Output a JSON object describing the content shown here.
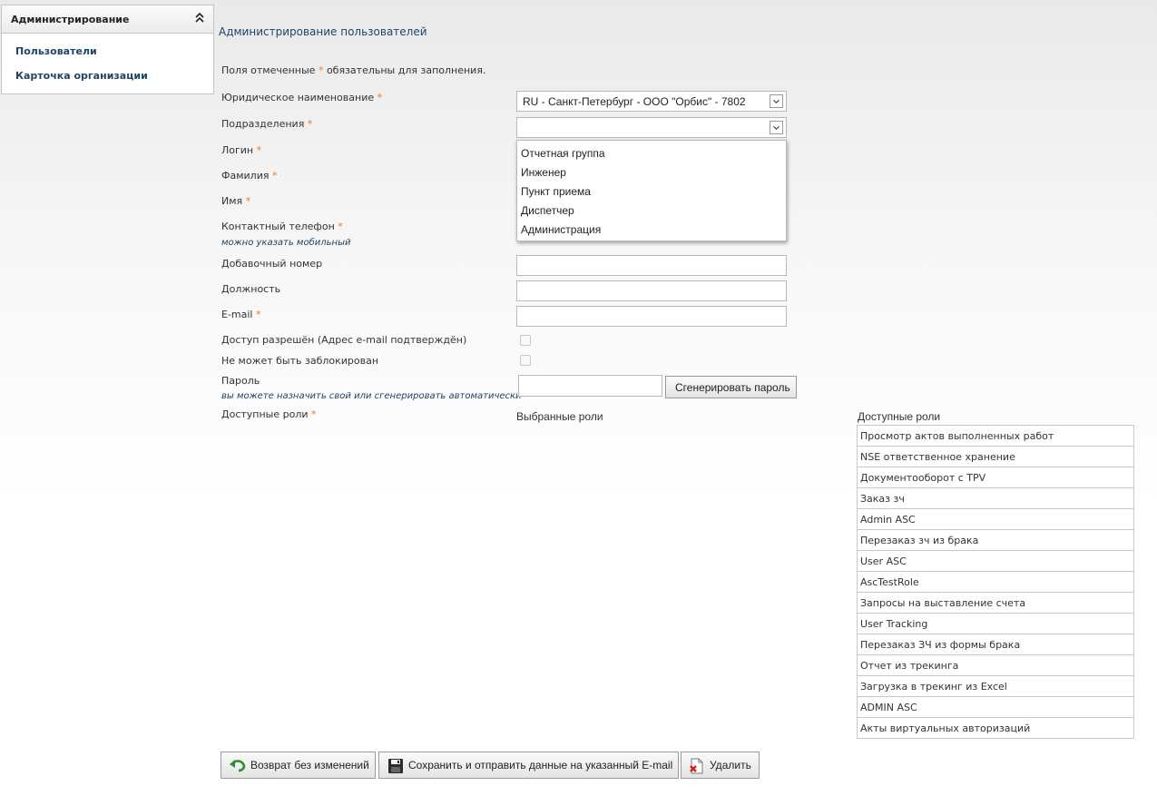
{
  "sidebar": {
    "title": "Администрирование",
    "items": [
      {
        "label": "Пользователи"
      },
      {
        "label": "Карточка организации"
      }
    ]
  },
  "page": {
    "heading": "Администрирование пользователей",
    "required_note_prefix": "Поля отмеченные",
    "required_star": "*",
    "required_note_suffix": "обязательны для заполнения."
  },
  "form": {
    "legal_name": {
      "label": "Юридическое наименование",
      "value": "RU - Санкт-Петербург - ООО \"Орбис\" - 7802"
    },
    "departments": {
      "label": "Подразделения",
      "value": "",
      "options": [
        "Отчетная группа",
        "Инженер",
        "Пункт приема",
        "Диспетчер",
        "Администрация"
      ]
    },
    "login": {
      "label": "Логин"
    },
    "surname": {
      "label": "Фамилия"
    },
    "name": {
      "label": "Имя"
    },
    "phone": {
      "label": "Контактный телефон",
      "hint": "можно указать мобильный"
    },
    "extension": {
      "label": "Добавочный номер",
      "value": ""
    },
    "position": {
      "label": "Должность",
      "value": ""
    },
    "email": {
      "label": "E-mail",
      "value": ""
    },
    "access_allowed": {
      "label": "Доступ разрешён (Адрес e-mail подтверждён)",
      "checked": false
    },
    "cannot_block": {
      "label": "Не может быть заблокирован",
      "checked": false
    },
    "password": {
      "label": "Пароль",
      "hint": "вы можете назначить свой или сгенерировать автоматически",
      "value": "",
      "generate_label": "Сгенерировать пароль"
    },
    "roles_label": "Доступные роли"
  },
  "roles": {
    "selected_header": "Выбранные роли",
    "available_header": "Доступные роли",
    "available": [
      "Просмотр актов выполненных работ",
      "NSE ответственное хранение",
      "Документооборот с TPV",
      "Заказ зч",
      "Admin ASC",
      "Перезаказ зч из брака",
      "User ASC",
      "AscTestRole",
      "Запросы на выставление счета",
      "User Tracking",
      "Перезаказ ЗЧ из формы брака",
      "Отчет из трекинга",
      "Загрузка в трекинг из Excel",
      "ADMIN ASC",
      "Акты виртуальных авторизаций"
    ]
  },
  "actions": {
    "back_label": "Возврат без изменений",
    "save_label": "Сохранить и отправить данные на указанный E-mail",
    "delete_label": "Удалить"
  },
  "colors": {
    "accent_star": "#f07a1e",
    "link": "#1e4466"
  },
  "icons": {
    "collapse": "double-chevron-up-icon",
    "select_arrow": "chevron-down-icon",
    "back": "undo-arrow-icon",
    "save": "floppy-disk-icon",
    "delete": "delete-document-icon"
  }
}
